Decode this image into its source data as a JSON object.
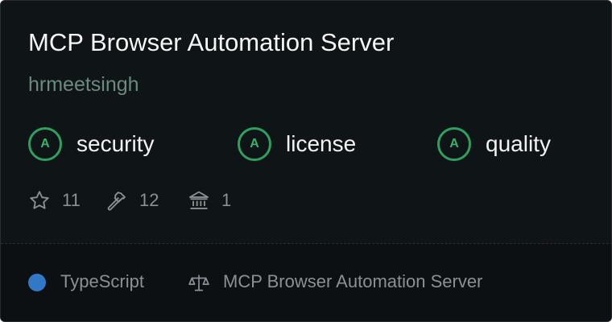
{
  "card": {
    "title": "MCP Browser Automation Server",
    "author": "hrmeetsingh",
    "grades": [
      {
        "grade": "A",
        "label": "security"
      },
      {
        "grade": "A",
        "label": "license"
      },
      {
        "grade": "A",
        "label": "quality"
      }
    ],
    "stats": {
      "stars": "11",
      "tools": "12",
      "resources": "1"
    },
    "footer": {
      "language": "TypeScript",
      "language_color": "#3178c6",
      "license": "MCP Browser Automation Server"
    }
  },
  "icons": {
    "stars": "star-icon",
    "tools": "hammer-icon",
    "resources": "bank-icon",
    "license": "scale-icon"
  }
}
